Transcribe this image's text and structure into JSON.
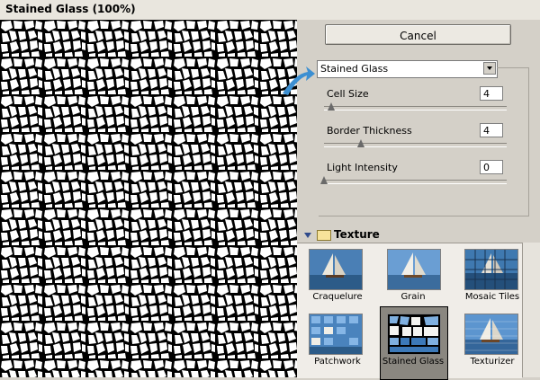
{
  "window": {
    "title": "Stained Glass (100%)"
  },
  "buttons": {
    "cancel": "Cancel"
  },
  "filter": {
    "selected": "Stained Glass"
  },
  "params": {
    "cell_size": {
      "label": "Cell Size",
      "value": "4",
      "level": 0.04
    },
    "border_thickness": {
      "label": "Border Thickness",
      "value": "4",
      "level": 0.2
    },
    "light_intensity": {
      "label": "Light Intensity",
      "value": "0",
      "level": 0.0
    }
  },
  "section": {
    "title": "Texture"
  },
  "gallery": {
    "items": [
      {
        "label": "Craquelure"
      },
      {
        "label": "Grain"
      },
      {
        "label": "Mosaic Tiles"
      },
      {
        "label": "Patchwork"
      },
      {
        "label": "Stained Glass",
        "selected": true
      },
      {
        "label": "Texturizer"
      }
    ]
  },
  "colors": {
    "accent_arrow": "#3c8fd2",
    "window_bg": "#d4d0c8"
  }
}
